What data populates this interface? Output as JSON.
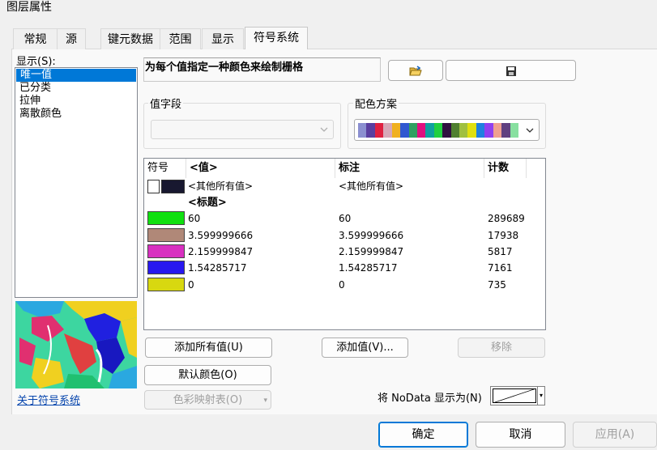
{
  "window": {
    "title": "图层属性"
  },
  "tabs": [
    {
      "label": "常规",
      "active": false
    },
    {
      "label": "源",
      "active": false
    },
    {
      "label": "键元数据",
      "active": false
    },
    {
      "label": "范围",
      "active": false
    },
    {
      "label": "显示",
      "active": false
    },
    {
      "label": "符号系统",
      "active": true
    }
  ],
  "show": {
    "label": "显示(S):",
    "items": [
      "唯一值",
      "已分类",
      "拉伸",
      "离散颜色"
    ],
    "selected": 0
  },
  "about_link": "关于符号系统",
  "description": "为每个值指定一种颜色来绘制栅格",
  "value_field": {
    "label": "值字段",
    "value": ""
  },
  "color_scheme": {
    "label": "配色方案",
    "colors": [
      "#8b8fd0",
      "#5a3ea0",
      "#e02040",
      "#d7a8b8",
      "#f0b020",
      "#3058d0",
      "#30a060",
      "#e01080",
      "#10a0a0",
      "#20d040",
      "#301040",
      "#508030",
      "#a0c040",
      "#e0e010",
      "#2080e0",
      "#9040f0",
      "#f0a090",
      "#604080",
      "#88e0a0"
    ]
  },
  "table": {
    "headers": {
      "symbol": "符号",
      "value": "<值>",
      "label": "标注",
      "count": "计数"
    },
    "others_row": {
      "value": "<其他所有值>",
      "label": "<其他所有值>"
    },
    "heading_row": {
      "value": "<标题>"
    },
    "rows": [
      {
        "color": "#10e010",
        "value": "60",
        "label": "60",
        "count": "289689"
      },
      {
        "color": "#b08878",
        "value": "3.599999666",
        "label": "3.599999666",
        "count": "17938"
      },
      {
        "color": "#d830c0",
        "value": "2.159999847",
        "label": "2.159999847",
        "count": "5817"
      },
      {
        "color": "#2818f0",
        "value": "1.54285717",
        "label": "1.54285717",
        "count": "7161"
      },
      {
        "color": "#d8d810",
        "value": "0",
        "label": "0",
        "count": "735"
      }
    ]
  },
  "buttons": {
    "add_all": "添加所有值(U)",
    "add_value": "添加值(V)...",
    "remove": "移除",
    "default_colors": "默认颜色(O)",
    "colormap": "色彩映射表(O)"
  },
  "nodata": {
    "label": "将 NoData 显示为(N)"
  },
  "footer": {
    "ok": "确定",
    "cancel": "取消",
    "apply": "应用(A)"
  }
}
